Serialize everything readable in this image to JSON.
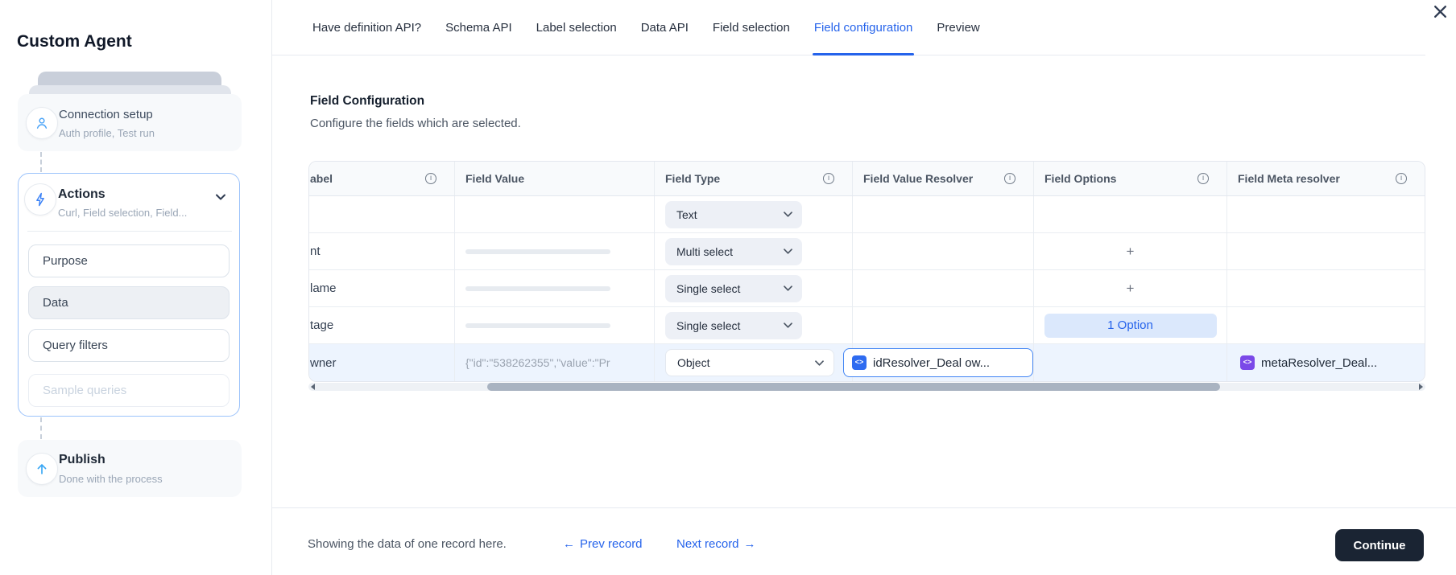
{
  "sidebar": {
    "title": "Custom Agent",
    "connection": {
      "title": "Connection setup",
      "subtitle": "Auth profile, Test run"
    },
    "actions": {
      "title": "Actions",
      "subtitle": "Curl, Field selection, Field..."
    },
    "action_buttons": [
      {
        "label": "Purpose",
        "state": "default"
      },
      {
        "label": "Data",
        "state": "selected"
      },
      {
        "label": "Query filters",
        "state": "default"
      },
      {
        "label": "Sample queries",
        "state": "disabled"
      }
    ],
    "publish": {
      "title": "Publish",
      "subtitle": "Done with the process"
    }
  },
  "tabs": {
    "items": [
      "Have definition API?",
      "Schema API",
      "Label selection",
      "Data API",
      "Field selection",
      "Field configuration",
      "Preview"
    ],
    "active": "Field configuration"
  },
  "section": {
    "title": "Field Configuration",
    "description": "Configure the fields which are selected."
  },
  "table": {
    "columns": [
      {
        "label": "abel",
        "info": true
      },
      {
        "label": "Field Value",
        "info": false
      },
      {
        "label": "Field Type",
        "info": true
      },
      {
        "label": "Field Value Resolver",
        "info": true
      },
      {
        "label": "Field Options",
        "info": true
      },
      {
        "label": "Field Meta resolver",
        "info": true
      }
    ],
    "rows": [
      {
        "label": "",
        "value": {
          "kind": "empty"
        },
        "field_type": "Text",
        "resolver": null,
        "options": null,
        "meta_resolver": null,
        "highlighted": false
      },
      {
        "label": "nt",
        "value": {
          "kind": "skeleton"
        },
        "field_type": "Multi select",
        "resolver": null,
        "options": {
          "kind": "add",
          "label": "+"
        },
        "meta_resolver": null,
        "highlighted": false
      },
      {
        "label": "lame",
        "value": {
          "kind": "skeleton"
        },
        "field_type": "Single select",
        "resolver": null,
        "options": {
          "kind": "add",
          "label": "+"
        },
        "meta_resolver": null,
        "highlighted": false
      },
      {
        "label": "tage",
        "value": {
          "kind": "skeleton"
        },
        "field_type": "Single select",
        "resolver": null,
        "options": {
          "kind": "pill",
          "label": "1 Option"
        },
        "meta_resolver": null,
        "highlighted": false
      },
      {
        "label": "wner",
        "value": {
          "kind": "text",
          "text": "{\"id\":\"538262355\",\"value\":\"Pr"
        },
        "field_type": "Object",
        "resolver": {
          "label": "idResolver_Deal ow...",
          "icon": "code-icon"
        },
        "options": null,
        "meta_resolver": {
          "label": "metaResolver_Deal...",
          "icon": "code-icon"
        },
        "highlighted": true
      }
    ]
  },
  "footer": {
    "status": "Showing the data of one record here.",
    "prev_label": "Prev record",
    "next_label": "Next record",
    "prev_arrow": "←",
    "next_arrow": "→",
    "continue_label": "Continue"
  },
  "colors": {
    "accent": "#2563eb",
    "active_row": "#edf4fe",
    "resolver_border": "#4285f4",
    "code_icon_blue": "#2e6bf0",
    "code_icon_purple": "#7a49e8",
    "continue_bg": "#1a2433"
  }
}
